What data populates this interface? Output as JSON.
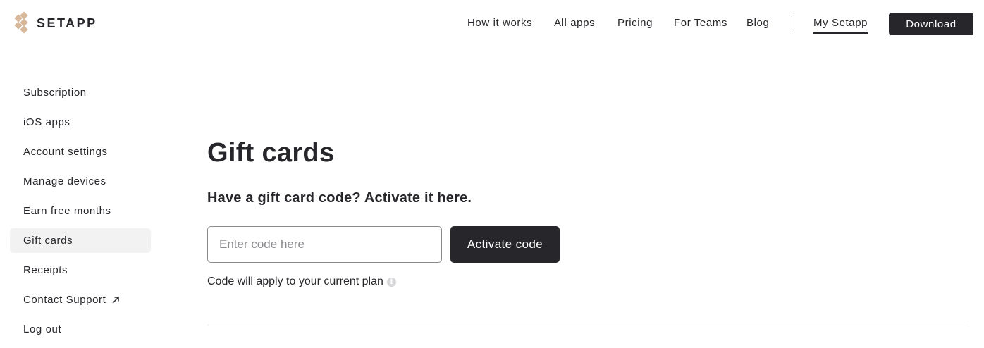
{
  "brand": {
    "name": "SETAPP",
    "logo_color": "#d7b89a"
  },
  "nav": {
    "items": [
      {
        "label": "How it works"
      },
      {
        "label": "All apps"
      },
      {
        "label": "Pricing"
      },
      {
        "label": "For Teams"
      },
      {
        "label": "Blog"
      }
    ],
    "account_label": "My Setapp",
    "download_label": "Download"
  },
  "sidebar": {
    "items": [
      {
        "label": "Subscription"
      },
      {
        "label": "iOS apps"
      },
      {
        "label": "Account settings"
      },
      {
        "label": "Manage devices"
      },
      {
        "label": "Earn free months"
      },
      {
        "label": "Gift cards",
        "active": true
      },
      {
        "label": "Receipts"
      },
      {
        "label": "Contact Support",
        "icon": "external-link-icon"
      },
      {
        "label": "Log out"
      }
    ]
  },
  "main": {
    "title": "Gift cards",
    "subtitle": "Have a gift card code? Activate it here.",
    "code_input": {
      "value": "",
      "placeholder": "Enter code here"
    },
    "activate_label": "Activate code",
    "note": "Code will apply to your current plan",
    "note_icon": "info-icon",
    "info_glyph": "i"
  },
  "colors": {
    "primary": "#26262b",
    "active_bg": "#f2f2f2"
  }
}
